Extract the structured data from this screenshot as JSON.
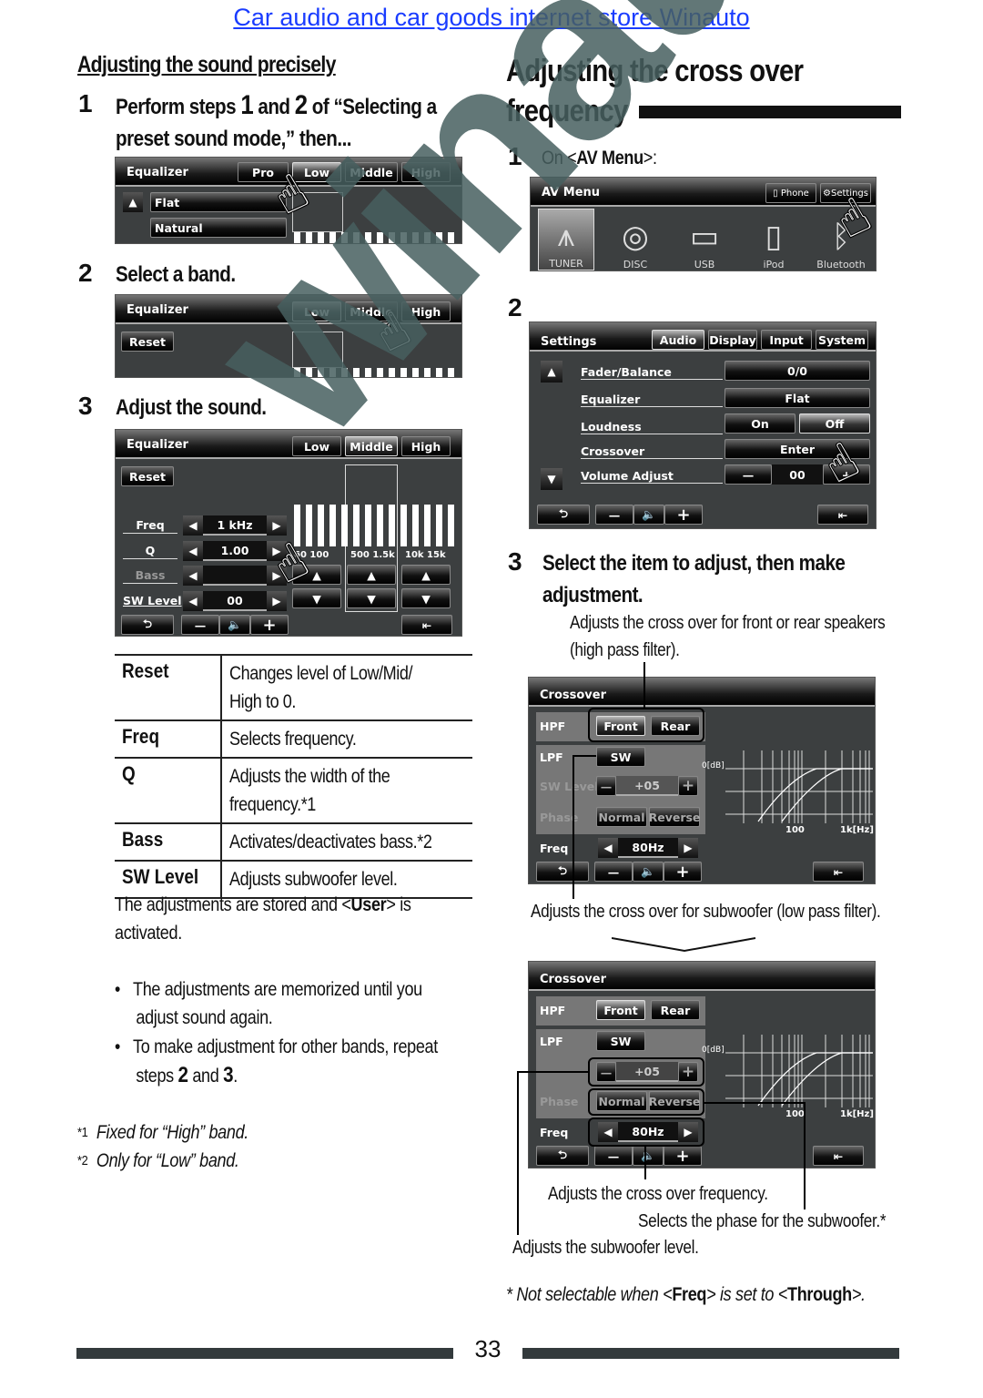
{
  "header_link": "Car audio and car goods internet store Winauto",
  "left": {
    "section_title": "Adjusting the sound precisely",
    "step1": {
      "num": "1",
      "text_a": "Perform steps ",
      "b1": "1",
      "text_b": " and ",
      "b2": "2",
      "text_c": " of “Selecting a",
      "line2": "preset sound mode,” then..."
    },
    "screen1": {
      "title": "Equalizer",
      "tabs": [
        "Pro",
        "Low",
        "Middle",
        "High"
      ],
      "presets": [
        "Flat",
        "Natural"
      ]
    },
    "step2": {
      "num": "2",
      "text": "Select a band."
    },
    "screen2": {
      "title": "Equalizer",
      "tabs": [
        "Low",
        "Middle",
        "High"
      ],
      "reset": "Reset"
    },
    "step3": {
      "num": "3",
      "text": "Adjust the sound."
    },
    "screen3": {
      "title": "Equalizer",
      "tabs": [
        "Low",
        "Middle",
        "High"
      ],
      "reset": "Reset",
      "rows": [
        {
          "label": "Freq",
          "value": "1 kHz"
        },
        {
          "label": "Q",
          "value": "1.00"
        },
        {
          "label": "Bass",
          "value": ""
        },
        {
          "label": "SW Level",
          "value": "00"
        }
      ],
      "band_labels": [
        "60 100",
        "500 1.5k",
        "10k 15k"
      ]
    },
    "table": [
      {
        "key": "Reset",
        "lines": [
          "Changes level of Low/Mid/",
          "High to 0."
        ]
      },
      {
        "key": "Freq",
        "lines": [
          "Selects frequency."
        ]
      },
      {
        "key": "Q",
        "lines": [
          "Adjusts the width of the",
          "frequency.*1"
        ]
      },
      {
        "key": "Bass",
        "lines": [
          "Activates/deactivates bass.*2"
        ]
      },
      {
        "key": "SW Level",
        "lines": [
          "Adjusts subwoofer level."
        ]
      }
    ],
    "stored_text_a": "The adjustments are stored and <",
    "stored_bold": "User",
    "stored_text_b": "> is",
    "stored_line2": "activated.",
    "bullets": [
      {
        "l1": "The adjustments are memorized until you",
        "l2": "adjust sound again."
      },
      {
        "l1": "To make adjustment for other bands, repeat",
        "l2a": "steps ",
        "b1": "2",
        "l2b": " and ",
        "b2": "3",
        "l2c": "."
      }
    ],
    "footnotes": [
      {
        "mark": "*1",
        "text": "Fixed for “High” band."
      },
      {
        "mark": "*2",
        "text": "Only for “Low” band."
      }
    ]
  },
  "right": {
    "title_l1": "Adjusting the cross over",
    "title_l2": "frequency",
    "step1": {
      "num": "1",
      "text_a": "On <",
      "bold": "AV Menu",
      "text_b": ">:"
    },
    "av_menu": {
      "title": "AV Menu",
      "buttons": [
        "Phone",
        "Settings"
      ],
      "sources": [
        "TUNER",
        "DISC",
        "USB",
        "iPod",
        "Bluetooth"
      ]
    },
    "step2": {
      "num": "2"
    },
    "settings": {
      "title": "Settings",
      "tabs": [
        "Audio",
        "Display",
        "Input",
        "System"
      ],
      "rows": [
        {
          "label": "Fader/Balance",
          "value": "0/0"
        },
        {
          "label": "Equalizer",
          "value": "Flat"
        },
        {
          "label": "Loudness",
          "on": "On",
          "off": "Off"
        },
        {
          "label": "Crossover",
          "value": "Enter"
        },
        {
          "label": "Volume Adjust",
          "value": "00"
        }
      ]
    },
    "step3": {
      "num": "3",
      "l1": "Select the item to adjust, then make",
      "l2": "adjustment."
    },
    "hpf_note_l1": "Adjusts the cross over for front or rear speakers",
    "hpf_note_l2": "(high pass filter).",
    "crossover": {
      "title": "Crossover",
      "hpf": "HPF",
      "front": "Front",
      "rear": "Rear",
      "lpf": "LPF",
      "sw": "SW",
      "sw_level": "SW Level",
      "sw_value": "+05",
      "phase": "Phase",
      "normal": "Normal",
      "reverse": "Reverse",
      "freq": "Freq",
      "freq_value": "80Hz",
      "graph_y": "0[dB]",
      "graph_x1": "100",
      "graph_x2": "1k[Hz]"
    },
    "lpf_note": "Adjusts the cross over for subwoofer (low pass filter).",
    "notes": {
      "freq": "Adjusts the cross over frequency.",
      "phase": "Selects the phase for the subwoofer.*",
      "level": "Adjusts the subwoofer level."
    },
    "footnote_a": "*  Not selectable when <",
    "footnote_b1": "Freq",
    "footnote_c": "> is set to <",
    "footnote_b2": "Through",
    "footnote_d": ">."
  },
  "page_number": "33",
  "watermark": "winauto.ua"
}
